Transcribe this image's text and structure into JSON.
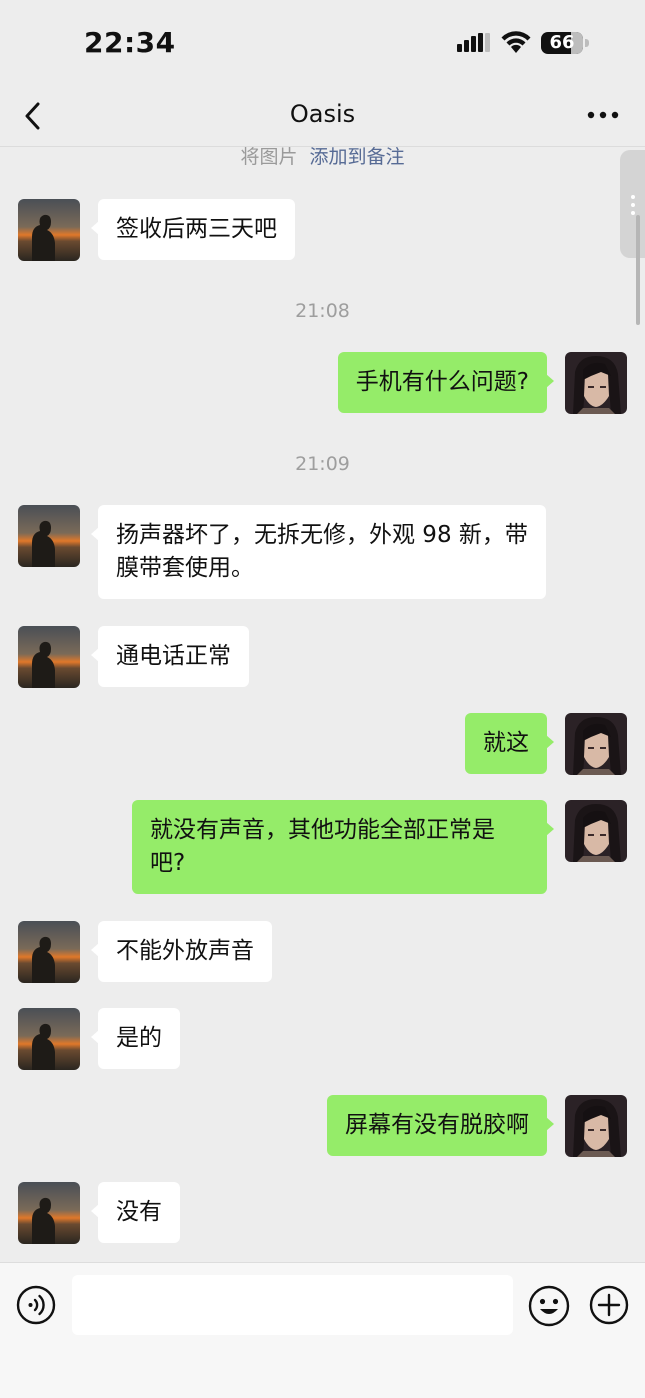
{
  "status_bar": {
    "time": "22:34",
    "battery_level": "66"
  },
  "nav": {
    "title": "Oasis"
  },
  "chat": {
    "hint_text": "将图片",
    "hint_link": "添加到备注",
    "messages": [
      {
        "side": "left",
        "text": "签收后两三天吧"
      },
      {
        "time": "21:08"
      },
      {
        "side": "right",
        "text": "手机有什么问题?"
      },
      {
        "time": "21:09"
      },
      {
        "side": "left",
        "text": "扬声器坏了，无拆无修，外观 98 新，带膜带套使用。"
      },
      {
        "side": "left",
        "text": "通电话正常"
      },
      {
        "side": "right",
        "text": "就这"
      },
      {
        "side": "right",
        "text": "就没有声音，其他功能全部正常是吧?"
      },
      {
        "side": "left",
        "text": "不能外放声音"
      },
      {
        "side": "left",
        "text": "是的"
      },
      {
        "side": "right",
        "text": "屏幕有没有脱胶啊"
      },
      {
        "side": "left",
        "text": "没有"
      }
    ]
  },
  "input_bar": {
    "placeholder": ""
  },
  "colors": {
    "sent_bubble": "#95ec69",
    "received_bubble": "#ffffff",
    "background": "#ededed",
    "link": "#576b95"
  },
  "icons": [
    "back-arrow-icon",
    "more-dots-icon",
    "signal-icon",
    "wifi-icon",
    "battery-icon",
    "voice-icon",
    "emoji-icon",
    "plus-icon"
  ]
}
